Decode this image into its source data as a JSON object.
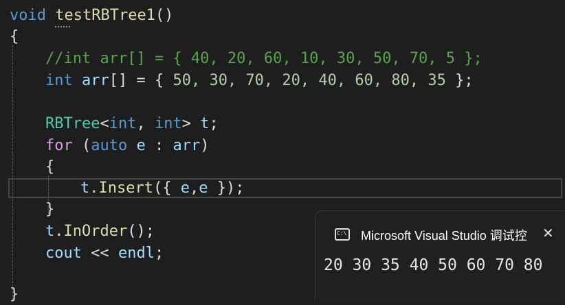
{
  "code": {
    "line1": {
      "kw": "void",
      "fn": "testRBTree1",
      "rest": "()"
    },
    "line2": {
      "text": "{"
    },
    "line3": {
      "comment": "//int arr[] = { 40, 20, 60, 10, 30, 50, 70, 5 };"
    },
    "line4": {
      "kw": "int",
      "var": "arr",
      "op": "[] = { ",
      "values": "50, 30, 70, 20, 40, 60, 80, 35",
      "end": " };"
    },
    "line6": {
      "type": "RBTree",
      "open": "<",
      "t1": "int",
      "comma": ", ",
      "t2": "int",
      "close": ">",
      "var": " t",
      "end": ";"
    },
    "line7": {
      "kw": "for",
      "open": " (",
      "kw2": "auto",
      "var": " e",
      "mid": " : ",
      "var2": "arr",
      "close": ")"
    },
    "line8": {
      "text": "{"
    },
    "line9": {
      "obj": "t",
      "dot": ".",
      "fn": "Insert",
      "args_open": "({ ",
      "a1": "e",
      "comma": ",",
      "a2": "e",
      "args_close": " });"
    },
    "line10": {
      "text": "}"
    },
    "line11": {
      "obj": "t",
      "dot": ".",
      "fn": "InOrder",
      "rest": "();"
    },
    "line12": {
      "obj": "cout",
      "op": " << ",
      "var": "endl",
      "end": ";"
    },
    "line14": {
      "text": "}"
    }
  },
  "console": {
    "title": "Microsoft Visual Studio 调试控",
    "icon": "console-window-icon",
    "icon_text": "C:\\",
    "close": "✕",
    "output": "20 30 35 40 50 60 70 80"
  }
}
